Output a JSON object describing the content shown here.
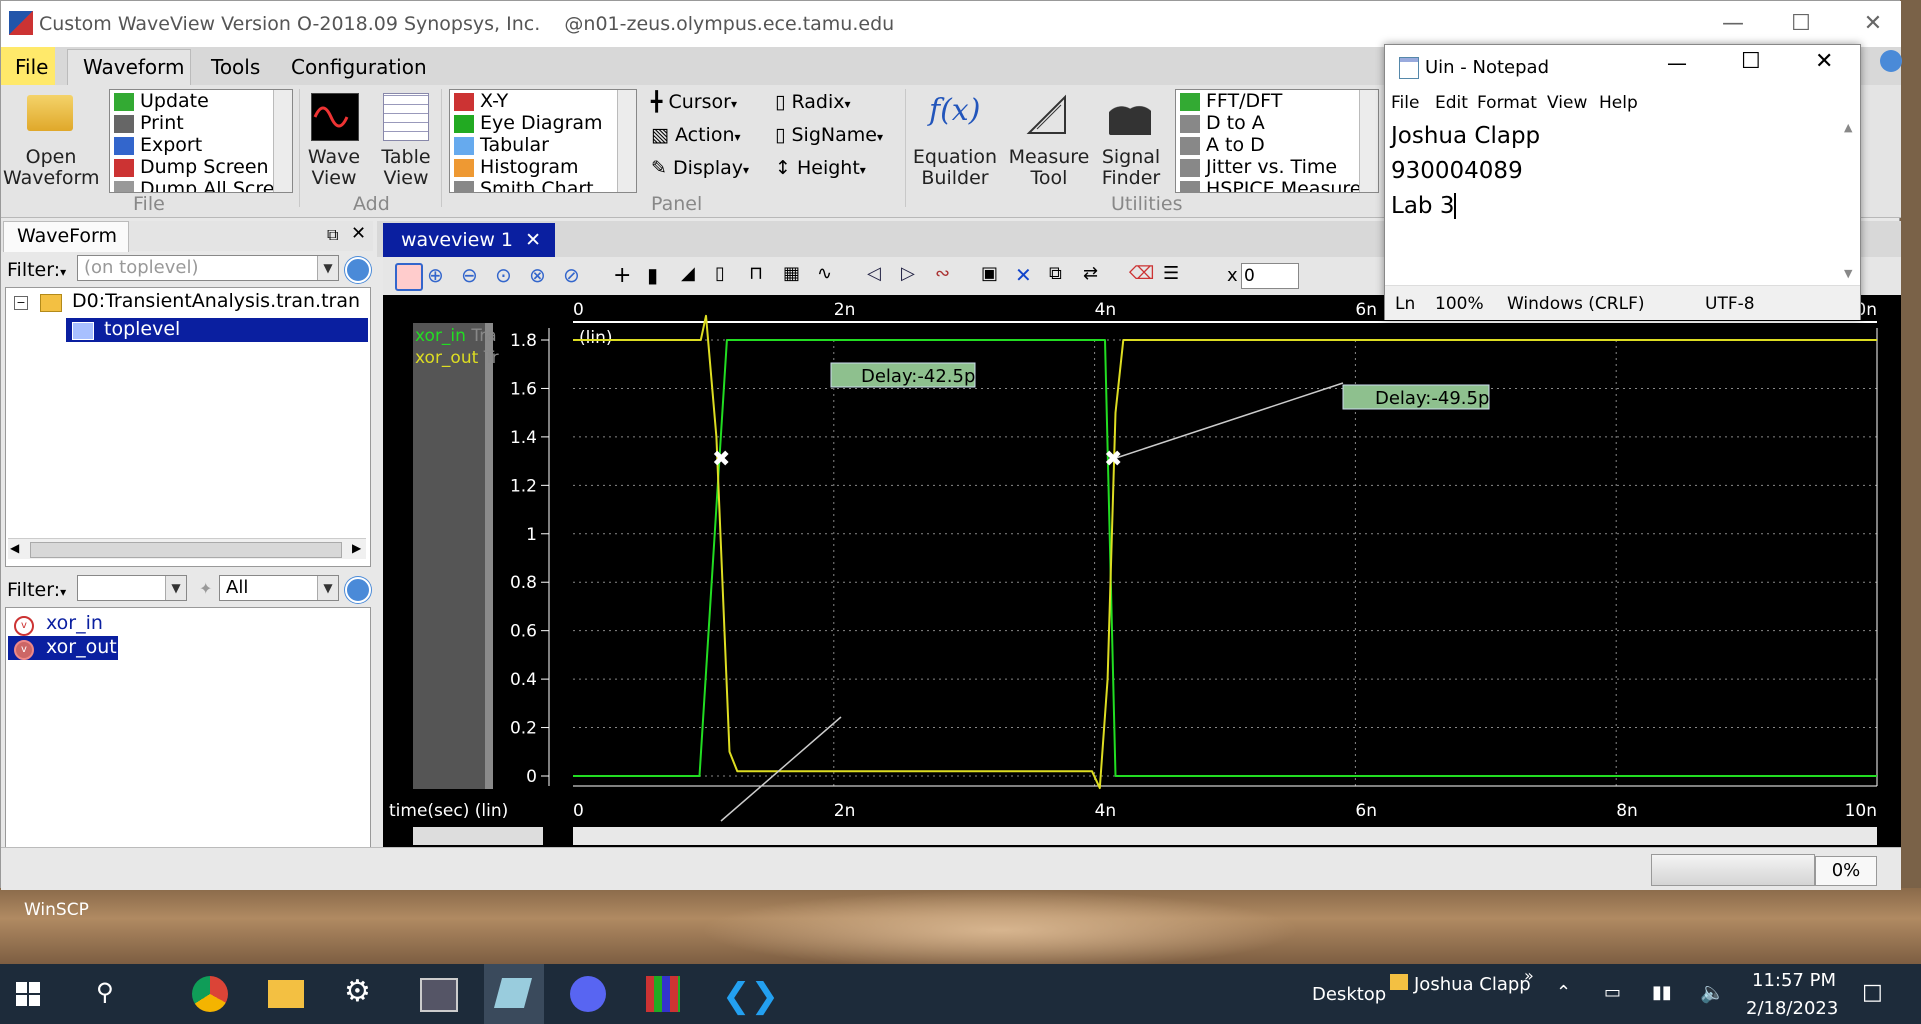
{
  "window": {
    "title": "Custom WaveView Version O-2018.09 Synopsys, Inc.",
    "host": "@n01-zeus.olympus.ece.tamu.edu"
  },
  "menu": [
    "File",
    "Waveform",
    "Tools",
    "Configuration"
  ],
  "ribbon": {
    "open_waveform": "Open\nWaveform",
    "file_list": [
      "Update",
      "Print",
      "Export",
      "Dump Screen",
      "Dump All Scre"
    ],
    "file_group": "File",
    "wave_view": "Wave\nView",
    "table_view": "Table\nView",
    "add_group": "Add",
    "panel_list": [
      "X-Y",
      "Eye Diagram",
      "Tabular",
      "Histogram",
      "Smith Chart"
    ],
    "cursor": "Cursor",
    "action": "Action",
    "display": "Display",
    "radix": "Radix",
    "signame": "SigName",
    "height": "Height",
    "panel_group": "Panel",
    "equation_builder": "Equation\nBuilder",
    "measure_tool": "Measure\nTool",
    "signal_finder": "Signal\nFinder",
    "util_list": [
      "FFT/DFT",
      "D to A",
      "A to D",
      "Jitter vs. Time",
      "HSPICE Measure"
    ],
    "utilities_group": "Utilities"
  },
  "left": {
    "waveform_tab": "WaveForm",
    "filter_label": "Filter:",
    "filter_value": "(on toplevel)",
    "tree_root": "D0:TransientAnalysis.tran.tran",
    "tree_child": "toplevel",
    "filter2_label": "Filter:",
    "filter2_all": "All",
    "signals": [
      "xor_in",
      "xor_out"
    ]
  },
  "waveview": {
    "tab": "waveview 1",
    "x_value": "0",
    "legend": [
      {
        "name": "xor_in",
        "suffix": "Tra",
        "color": "#22dd22"
      },
      {
        "name": "xor_out",
        "suffix": "Tr",
        "color": "#dddd22"
      }
    ],
    "ylabel_unit": "(lin)",
    "xlabel": "time(sec) (lin)",
    "x_ticks": [
      "0",
      "2n",
      "4n",
      "6n",
      "8n",
      "10n"
    ],
    "y_ticks": [
      "1.8",
      "1.6",
      "1.4",
      "1.2",
      "1",
      "0.8",
      "0.6",
      "0.4",
      "0.2",
      "0"
    ],
    "delay1": "Delay:-42.5p",
    "delay2": "Delay:-49.5p"
  },
  "chart_data": {
    "type": "line",
    "xlabel": "time(sec) (lin)",
    "ylabel": "(lin)",
    "xlim": [
      0,
      10
    ],
    "ylim": [
      0,
      1.9
    ],
    "x_unit": "ns",
    "series": [
      {
        "name": "xor_in",
        "color": "#22dd22",
        "x": [
          0,
          0.97,
          1.18,
          4.08,
          4.16,
          10
        ],
        "y": [
          0,
          0,
          1.8,
          1.8,
          0,
          0
        ]
      },
      {
        "name": "xor_out",
        "color": "#dddd22",
        "x": [
          0,
          0.98,
          1.02,
          1.1,
          1.2,
          1.26,
          3.98,
          4.04,
          4.1,
          4.16,
          4.22,
          10
        ],
        "y": [
          1.8,
          1.8,
          1.9,
          1.4,
          0.1,
          0.02,
          0.02,
          -0.05,
          0.4,
          1.5,
          1.8,
          1.8
        ]
      }
    ],
    "annotations": [
      "Delay:-42.5p",
      "Delay:-49.5p"
    ]
  },
  "status": {
    "progress": "0%"
  },
  "notepad": {
    "title": "Uin - Notepad",
    "menu": [
      "File",
      "Edit",
      "Format",
      "View",
      "Help"
    ],
    "lines": [
      "Joshua Clapp",
      "930004089",
      "Lab 3"
    ],
    "status_ln": "Ln",
    "status_zoom": "100%",
    "status_eol": "Windows (CRLF)",
    "status_enc": "UTF-8"
  },
  "desktop": {
    "winscp": "WinSCP"
  },
  "taskbar": {
    "desktop": "Desktop",
    "user": "Joshua Clapp",
    "time": "11:57 PM",
    "date": "2/18/2023"
  }
}
